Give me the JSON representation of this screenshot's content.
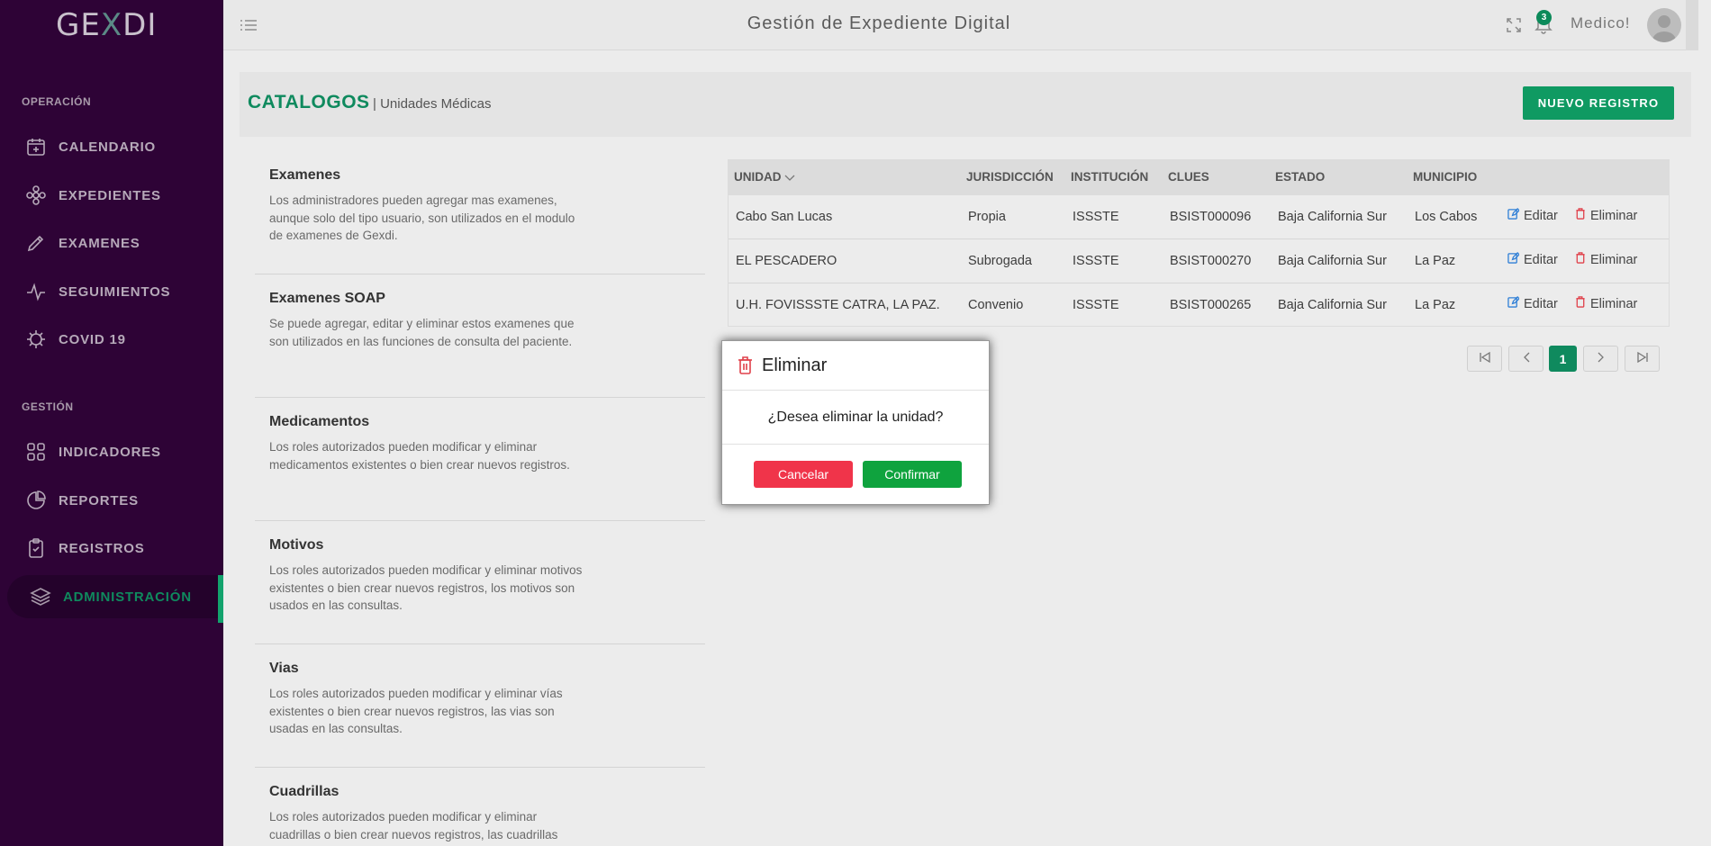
{
  "app": {
    "logo": "GEXDI",
    "title": "Gestión de Expediente Digital",
    "notifications_count": "3",
    "user_name": "Medico!"
  },
  "sidebar": {
    "section_operation": "OPERACIÓN",
    "section_management": "GESTIÓN",
    "items": [
      {
        "label": "CALENDARIO",
        "icon": "calendar-plus-icon"
      },
      {
        "label": "EXPEDIENTES",
        "icon": "flower-icon"
      },
      {
        "label": "EXAMENES",
        "icon": "pen-icon"
      },
      {
        "label": "SEGUIMIENTOS",
        "icon": "pulse-icon"
      },
      {
        "label": "COVID 19",
        "icon": "virus-icon"
      },
      {
        "label": "INDICADORES",
        "icon": "grid-icon"
      },
      {
        "label": "REPORTES",
        "icon": "pie-chart-icon"
      },
      {
        "label": "REGISTROS",
        "icon": "clipboard-check-icon"
      },
      {
        "label": "ADMINISTRACIÓN",
        "icon": "layers-icon",
        "active": true
      }
    ]
  },
  "header": {
    "title": "CATALOGOS",
    "subtitle": "| Unidades Médicas",
    "new_button": "NUEVO REGISTRO"
  },
  "catalogs": [
    {
      "title": "Examenes",
      "description": "Los administradores pueden agregar mas examenes, aunque solo del tipo usuario, son utilizados en el modulo de examenes de Gexdi."
    },
    {
      "title": "Examenes SOAP",
      "description": "Se puede agregar, editar y eliminar estos examenes que son utilizados en las funciones de consulta del paciente."
    },
    {
      "title": "Medicamentos",
      "description": "Los roles autorizados pueden modificar y eliminar medicamentos existentes o bien crear nuevos registros."
    },
    {
      "title": "Motivos",
      "description": "Los roles autorizados pueden modificar y eliminar motivos existentes o bien crear nuevos registros, los motivos son usados en las consultas."
    },
    {
      "title": "Vias",
      "description": "Los roles autorizados pueden modificar y eliminar vías existentes o bien crear nuevos registros, las vias son usadas en las consultas."
    },
    {
      "title": "Cuadrillas",
      "description": "Los roles autorizados pueden modificar y eliminar cuadrillas o bien crear nuevos registros, las cuadrillas"
    }
  ],
  "table": {
    "columns": [
      "UNIDAD",
      "JURISDICCIÓN",
      "INSTITUCIÓN",
      "CLUES",
      "ESTADO",
      "MUNICIPIO"
    ],
    "rows": [
      [
        "Cabo San Lucas",
        "Propia",
        "ISSSTE",
        "BSIST000096",
        "Baja California Sur",
        "Los Cabos"
      ],
      [
        "EL PESCADERO",
        "Subrogada",
        "ISSSTE",
        "BSIST000270",
        "Baja California Sur",
        "La Paz"
      ],
      [
        "U.H. FOVISSSTE CATRA, LA PAZ.",
        "Convenio",
        "ISSSTE",
        "BSIST000265",
        "Baja California Sur",
        "La Paz"
      ]
    ],
    "edit_label": "Editar",
    "delete_label": "Eliminar"
  },
  "pagination": {
    "current_page": "1"
  },
  "modal": {
    "title": "Eliminar",
    "message": "¿Desea eliminar la unidad?",
    "cancel": "Cancelar",
    "confirm": "Confirmar"
  },
  "colors": {
    "sidebar_bg": "#2e0336",
    "accent_green": "#0f8a5e",
    "danger": "#f0344a",
    "confirm": "#0fa33e"
  }
}
